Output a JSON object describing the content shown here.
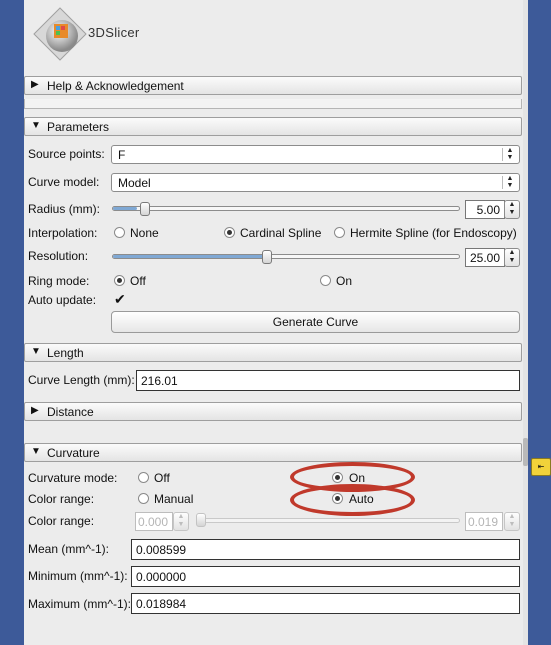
{
  "app": {
    "logo_text": "3DSlicer"
  },
  "sections": {
    "help": {
      "title": "Help & Acknowledgement",
      "expanded": false
    },
    "parameters": {
      "title": "Parameters",
      "expanded": true
    },
    "length": {
      "title": "Length",
      "expanded": true
    },
    "distance": {
      "title": "Distance",
      "expanded": false
    },
    "curvature": {
      "title": "Curvature",
      "expanded": true
    }
  },
  "parameters": {
    "source_points_label": "Source points:",
    "source_points_value": "F",
    "curve_model_label": "Curve model:",
    "curve_model_value": "Model",
    "radius_label": "Radius (mm):",
    "radius_value": "5.00",
    "radius_fraction": 0.07,
    "interpolation_label": "Interpolation:",
    "interpolation_options": [
      "None",
      "Cardinal Spline",
      "Hermite Spline (for Endoscopy)"
    ],
    "interpolation_selected": "Cardinal Spline",
    "resolution_label": "Resolution:",
    "resolution_value": "25.00",
    "resolution_fraction": 0.45,
    "ring_mode_label": "Ring mode:",
    "ring_mode_options": [
      "Off",
      "On"
    ],
    "ring_mode_selected": "Off",
    "auto_update_label": "Auto update:",
    "auto_update_checked": true,
    "check_glyph": "✔",
    "generate_button": "Generate Curve"
  },
  "length": {
    "curve_length_label": "Curve Length (mm):",
    "curve_length_value": "216.01"
  },
  "curvature": {
    "mode_label": "Curvature mode:",
    "mode_options": [
      "Off",
      "On"
    ],
    "mode_selected": "On",
    "color_range_label": "Color range:",
    "color_range_options": [
      "Manual",
      "Auto"
    ],
    "color_range_selected": "Auto",
    "color_range2_label": "Color range:",
    "range_min": "0.000",
    "range_max": "0.019",
    "mean_label": "Mean (mm^-1):",
    "mean_value": "0.008599",
    "minimum_label": "Minimum (mm^-1):",
    "minimum_value": "0.000000",
    "maximum_label": "Maximum (mm^-1):",
    "maximum_value": "0.018984"
  },
  "icons": {
    "collapsed": "▶",
    "expanded": "▼",
    "combo_arrows": "▲▼"
  },
  "colors": {
    "background": "#3d5a99",
    "highlight": "#c0392b",
    "slider_fill": "#7fa8d4"
  }
}
